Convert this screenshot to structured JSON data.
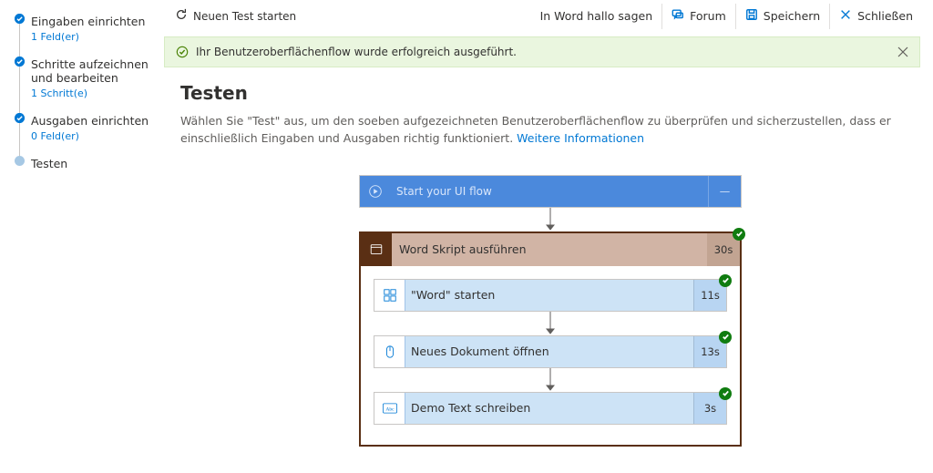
{
  "cmdbar": {
    "new_test_label": "Neuen Test starten",
    "flow_name": "In Word hallo sagen",
    "forum_label": "Forum",
    "save_label": "Speichern",
    "close_label": "Schließen"
  },
  "banner": {
    "message": "Ihr Benutzeroberflächenflow wurde erfolgreich ausgeführt."
  },
  "sidebar": {
    "steps": [
      {
        "title": "Eingaben einrichten",
        "meta": "1 Feld(er)",
        "done": true
      },
      {
        "title": "Schritte aufzeichnen und bearbeiten",
        "meta": "1 Schritt(e)",
        "done": true
      },
      {
        "title": "Ausgaben einrichten",
        "meta": "0 Feld(er)",
        "done": true
      },
      {
        "title": "Testen",
        "meta": "",
        "done": false
      }
    ]
  },
  "page": {
    "heading": "Testen",
    "description_pre": "Wählen Sie \"Test\" aus, um den soeben aufgezeichneten Benutzeroberflächenflow zu überprüfen und sicherzustellen, dass er einschließlich Eingaben und Ausgaben richtig funktioniert. ",
    "description_link": "Weitere Informationen"
  },
  "flow": {
    "start": {
      "label": "Start your UI flow",
      "time": "—"
    },
    "container": {
      "label": "Word Skript ausführen",
      "time": "30s"
    },
    "steps": [
      {
        "icon": "grid",
        "label": "\"Word\" starten",
        "time": "11s"
      },
      {
        "icon": "mouse",
        "label": "Neues Dokument öffnen",
        "time": "13s"
      },
      {
        "icon": "abc",
        "label": "Demo Text schreiben",
        "time": "3s"
      }
    ]
  }
}
